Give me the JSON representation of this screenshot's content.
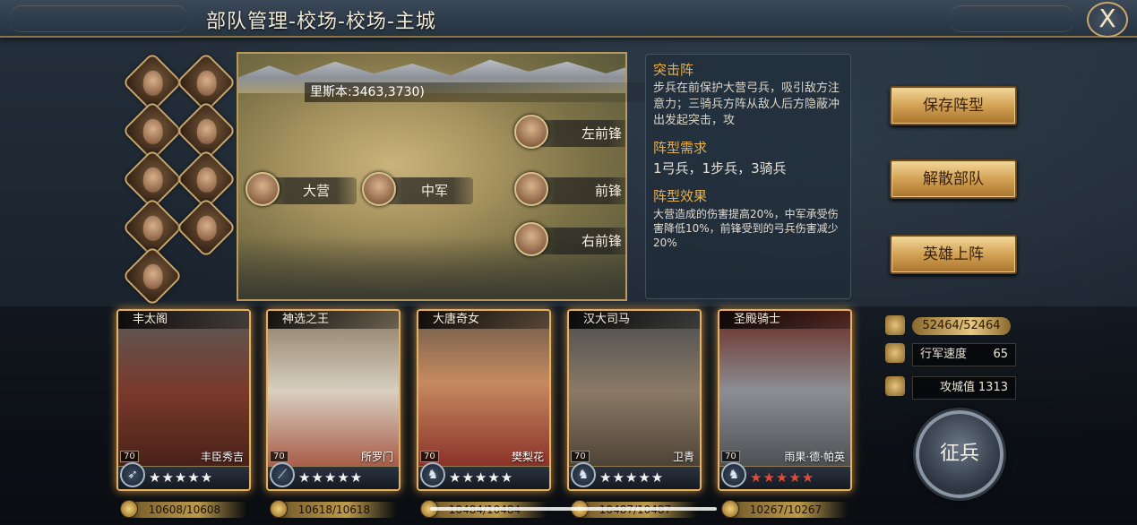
{
  "title": "部队管理-校场-校场-主城",
  "close_label": "X",
  "map": {
    "coordinate": "里斯本:3463,3730)",
    "slots": {
      "left_vanguard": "左前锋",
      "main_camp": "大营",
      "center_army": "中军",
      "vanguard": "前锋",
      "right_vanguard": "右前锋"
    }
  },
  "formation": {
    "name": "突击阵",
    "description": "步兵在前保护大营弓兵，吸引敌方注意力；三骑兵方阵从敌人后方隐蔽冲出发起突击，攻",
    "req_title": "阵型需求",
    "req_value": "1弓兵，1步兵，3骑兵",
    "effect_title": "阵型效果",
    "effect_value": "大营造成的伤害提高20%，中军承受伤害降低10%，前锋受到的弓兵伤害减少20%"
  },
  "actions": {
    "save": "保存阵型",
    "disband": "解散部队",
    "deploy": "英雄上阵"
  },
  "cards": [
    {
      "title": "丰太阁",
      "name": "丰臣秀吉",
      "level": "70",
      "stars": "★★★★★",
      "troops": "10608/10608",
      "type_icon": "bow-icon"
    },
    {
      "title": "神选之王",
      "name": "所罗门",
      "level": "70",
      "stars": "★★★★★",
      "troops": "10618/10618",
      "type_icon": "spear-icon"
    },
    {
      "title": "大唐奇女",
      "name": "樊梨花",
      "level": "70",
      "stars": "★★★★★",
      "troops": "10484/10484",
      "type_icon": "horse-icon"
    },
    {
      "title": "汉大司马",
      "name": "卫青",
      "level": "70",
      "stars": "★★★★★",
      "troops": "10487/10487",
      "type_icon": "horse-icon"
    },
    {
      "title": "圣殿骑士",
      "name": "雨果·德·帕英",
      "level": "70",
      "stars": "★★★★★",
      "troops": "10267/10267",
      "type_icon": "horse-icon"
    }
  ],
  "stats": {
    "total_troops": "52464/52464",
    "march_speed_label": "行军速度",
    "march_speed_value": "65",
    "siege_label": "攻城值",
    "siege_value": "1313"
  },
  "recruit_label": "征兵"
}
